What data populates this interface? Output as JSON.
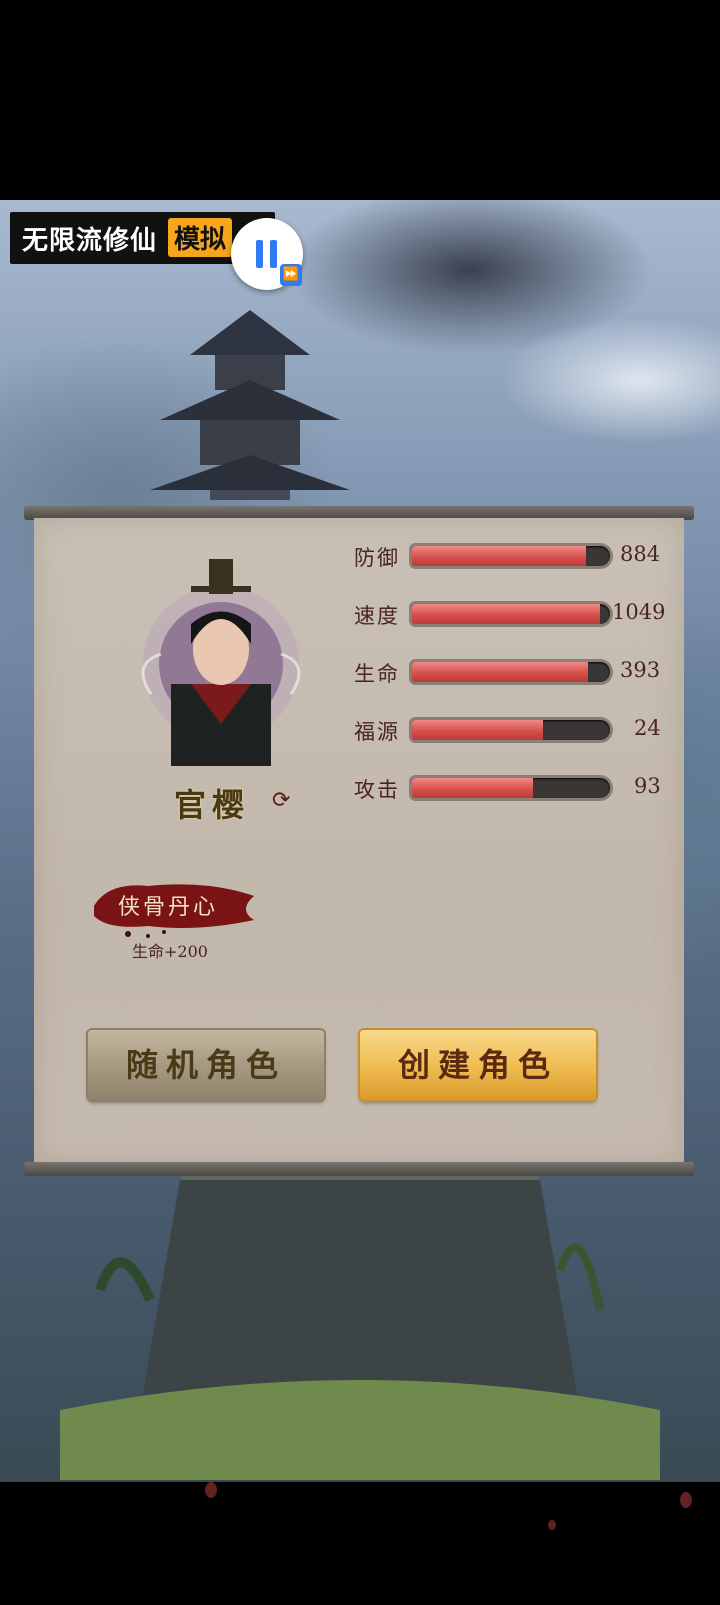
{
  "ad_overlay": {
    "title": "无限流修仙",
    "tag": "模拟"
  },
  "character": {
    "name": "官樱"
  },
  "stats": [
    {
      "label": "防御",
      "value": "884",
      "fill": 0.88
    },
    {
      "label": "速度",
      "value": "1049",
      "fill": 0.95
    },
    {
      "label": "生命",
      "value": "393",
      "fill": 0.89
    },
    {
      "label": "福源",
      "value": "24",
      "fill": 0.66
    },
    {
      "label": "攻击",
      "value": "93",
      "fill": 0.61
    }
  ],
  "trait": {
    "name": "侠骨丹心",
    "effect": "生命+200"
  },
  "buttons": {
    "random": "随机角色",
    "create": "创建角色"
  },
  "colors": {
    "bar_fill": "#d6504c",
    "create_button": "#efbb4f",
    "random_button": "#a79a82"
  }
}
